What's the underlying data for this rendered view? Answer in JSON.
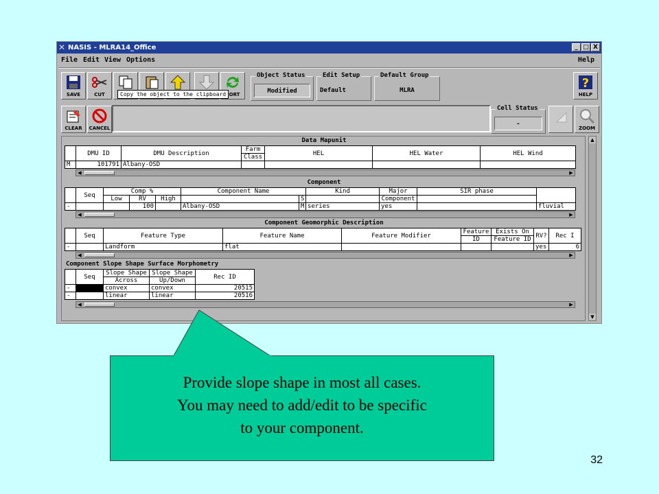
{
  "window": {
    "title": "NASIS - MLRA14_Office",
    "controls": [
      "_",
      "□",
      "X"
    ]
  },
  "menu": {
    "file": "File",
    "edit": "Edit",
    "view": "View",
    "options": "Options",
    "help": "Help"
  },
  "toolbar": {
    "save": "SAVE",
    "cut": "CUT",
    "sort": "SORT",
    "help": "HELP",
    "clear": "CLEAR",
    "cancel": "CANCEL",
    "zoom": "ZOOM",
    "tooltip": "Copy the object to the clipboard",
    "object_status": {
      "label": "Object Status",
      "value": "Modified"
    },
    "edit_setup": {
      "label": "Edit Setup",
      "value": "Default"
    },
    "default_group": {
      "label": "Default Group",
      "value": "MLRA"
    },
    "cell_status": {
      "label": "Cell Status",
      "value": "-"
    }
  },
  "data_mapunit": {
    "title": "Data Mapunit",
    "headers": [
      "DMU ID",
      "DMU Description",
      "Farm Class",
      "HEL",
      "HEL Water",
      "HEL Wind"
    ],
    "farm_class_a": "Farm",
    "farm_class_b": "Class",
    "row": {
      "marker": "M",
      "dmu_id": "101791",
      "desc": "Albany-OSD"
    }
  },
  "component": {
    "title": "Component",
    "h_seq": "Seq",
    "h_comp": "Comp %",
    "h_low": "Low",
    "h_rv": "RV",
    "h_high": "High",
    "h_name": "Component Name",
    "h_s": "S",
    "h_kind": "Kind",
    "h_major_a": "Major",
    "h_major_b": "Component",
    "h_sir": "SIR phase",
    "row": {
      "marker": "-",
      "rv": "100",
      "name": "Albany-OSD",
      "s": "M",
      "kind": "series",
      "major": "yes",
      "extra": "fluvial"
    }
  },
  "geomorphic": {
    "title": "Component Geomorphic Description",
    "h_seq": "Seq",
    "h_type": "Feature Type",
    "h_name": "Feature Name",
    "h_mod": "Feature Modifier",
    "h_fid_a": "Feature",
    "h_fid_b": "ID",
    "h_exists_a": "Exists On",
    "h_exists_b": "Feature ID",
    "h_rv": "RV?",
    "h_rec": "Rec I",
    "row": {
      "marker": "-",
      "type": "Landform",
      "name": "flat",
      "rv": "yes",
      "rec": "6"
    }
  },
  "slope_shape": {
    "title": "Component Slope Shape Surface Morphometry",
    "h_seq": "Seq",
    "h_across_a": "Slope Shape",
    "h_across_b": "Across",
    "h_updown_a": "Slope Shape",
    "h_updown_b": "Up/Down",
    "h_rec": "Rec ID",
    "rows": [
      {
        "marker": "-",
        "across": "convex",
        "updown": "convex",
        "rec": "20515"
      },
      {
        "marker": "-",
        "across": "linear",
        "updown": "linear",
        "rec": "20516"
      }
    ]
  },
  "callout": {
    "line1": "Provide slope shape in most all cases.",
    "line2": "You may need to add/edit to be specific",
    "line3": "to your component."
  },
  "slide_number": "32"
}
